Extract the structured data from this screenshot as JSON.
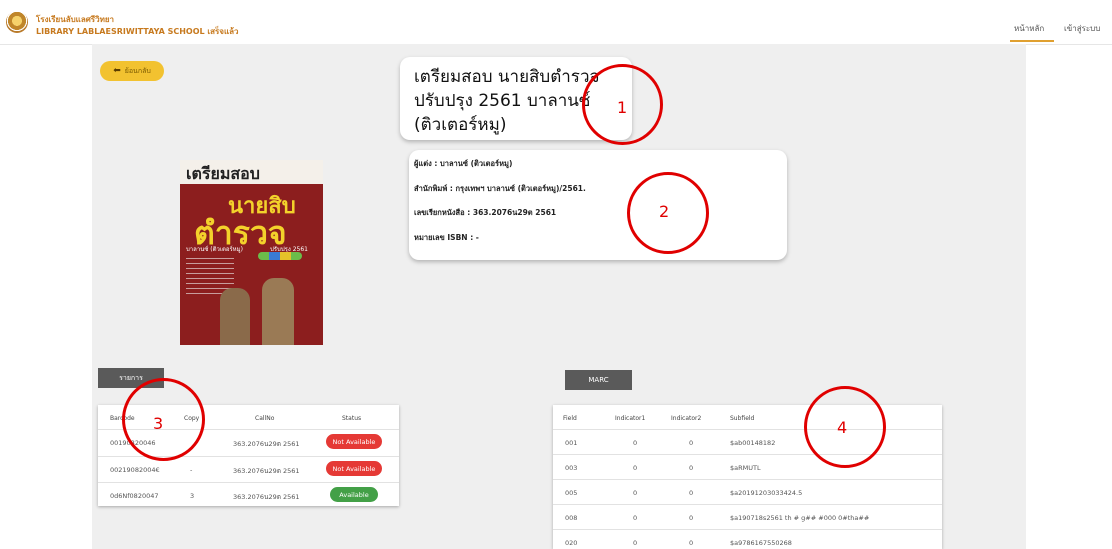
{
  "header": {
    "school_name_th": "โรงเรียนลับแลศรีวิทยา",
    "school_name_en": "LIBRARY LABLAESRIWITTAYA SCHOOL เสร็จแล้ว",
    "nav": [
      {
        "label": "หน้าหลัก",
        "active": true
      },
      {
        "label": "เข้าสู่ระบบ",
        "active": false
      }
    ]
  },
  "back_button": {
    "icon": "reply-arrow-icon",
    "label": "ย้อนกลับ"
  },
  "book": {
    "title": "เตรียมสอบ นายสิบตำรวจ\nปรับปรุง 2561 บาลานซ์\n(ติวเตอร์หมู)",
    "author": "ผู้แต่ง : บาลานซ์ (ติวเตอร์หมู)",
    "publisher": "สำนักพิมพ์ : กรุงเทพฯ บาลานซ์ (ติวเตอร์หมู)/2561.",
    "call_number": "เลขเรียกหนังสือ : 363.2076น29ต 2561",
    "isbn": "หมายเลข ISBN : -",
    "cover": {
      "line1": "เตรียมสอบ",
      "line2": "นายสิบ",
      "line3": "ตำรวจ",
      "line4": "ปรับปรุง 2561",
      "line5": "บาลานซ์ (ติวเตอร์หมู)"
    }
  },
  "items_table": {
    "tab_label": "รายการ",
    "headers": [
      "Barcode",
      "Copy",
      "CallNo",
      "Status"
    ],
    "rows": [
      {
        "barcode": "00190820046",
        "copy": "",
        "callno": "363.2076น29ต 2561",
        "status": "Not Available",
        "status_color": "#e53935"
      },
      {
        "barcode": "00219082004€",
        "copy": "-",
        "callno": "363.2076น29ต 2561",
        "status": "Not Available",
        "status_color": "#e53935"
      },
      {
        "barcode": "0d6Nf0820047",
        "copy": "3",
        "callno": "363.2076น29ต 2561",
        "status": "Available",
        "status_color": "#43a047"
      }
    ]
  },
  "marc_table": {
    "tab_label": "MARC",
    "headers": [
      "Field",
      "Indicator1",
      "Indicator2",
      "Subfield"
    ],
    "rows": [
      {
        "field": "001",
        "ind1": "0",
        "ind2": "0",
        "subfield": "$ab00148182"
      },
      {
        "field": "003",
        "ind1": "0",
        "ind2": "0",
        "subfield": "$aRMUTL"
      },
      {
        "field": "005",
        "ind1": "0",
        "ind2": "0",
        "subfield": "$a20191203033424.5"
      },
      {
        "field": "008",
        "ind1": "0",
        "ind2": "0",
        "subfield": "$a190718s2561 th # g## #000 0#tha##"
      },
      {
        "field": "020",
        "ind1": "0",
        "ind2": "0",
        "subfield": "$a9786167550268"
      }
    ]
  },
  "annotations": [
    "1",
    "2",
    "3",
    "4"
  ],
  "colors": {
    "accent": "#f2c230",
    "brand": "#c77a1f",
    "annotation": "#e00000"
  }
}
